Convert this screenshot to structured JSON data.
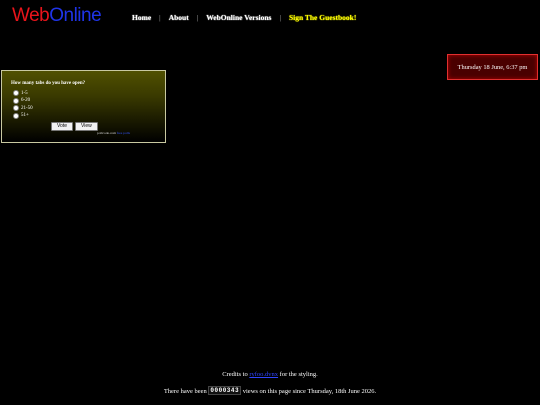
{
  "logo": {
    "part1": "Web",
    "part2": "Online"
  },
  "nav": {
    "home": "Home",
    "about": "About",
    "versions": "WebOnline Versions",
    "guestbook": "Sign The Guestbook!",
    "separator": "|"
  },
  "clock": {
    "text": "Thursday 18 June, 6:37 pm"
  },
  "poll": {
    "question": "How many tabs do you have open?",
    "options": [
      "1-5",
      "6-20",
      "21-50",
      "51+"
    ],
    "vote_label": "Vote",
    "view_label": "View",
    "credit_prefix": "pollcode.com",
    "credit_link": "free polls"
  },
  "footer": {
    "credits_prefix": "Credits to",
    "credits_link": "ryfoo.dvnx",
    "credits_suffix": "for the styling.",
    "views_prefix": "There have been",
    "views_count": "0000343",
    "views_suffix": "views on this page since Thursday, 18th June 2026."
  },
  "colors": {
    "background": "#000000",
    "logo_web": "#e8141b",
    "logo_online": "#1f34e8",
    "guestbook": "#ffff00",
    "clock_border": "#e03030",
    "link": "#2f45ff"
  }
}
